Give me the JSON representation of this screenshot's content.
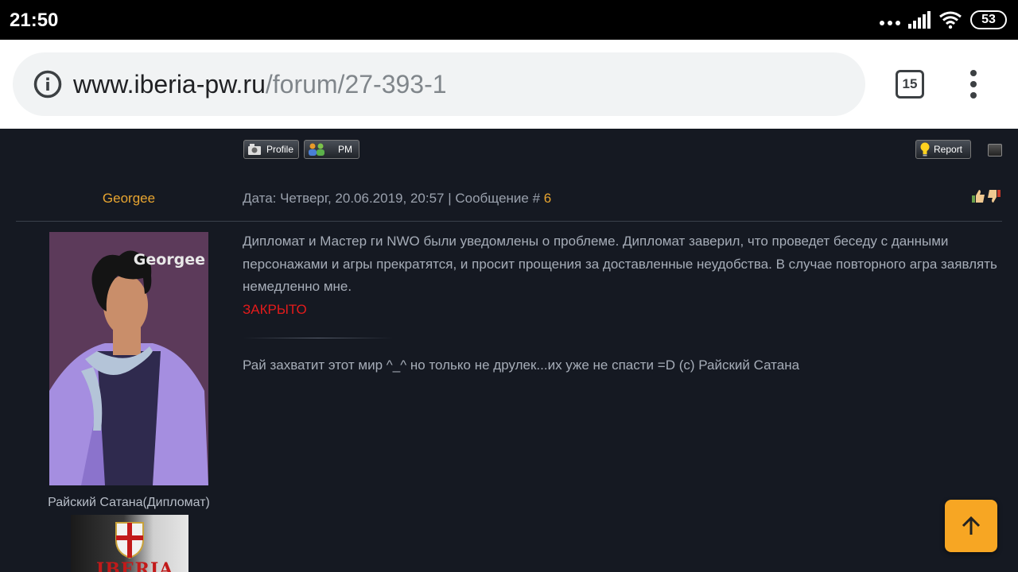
{
  "status": {
    "time": "21:50",
    "battery": "53"
  },
  "browser": {
    "url_host": "www.iberia-pw.ru",
    "url_path": "/forum/27-393-1",
    "tab_count": "15"
  },
  "post": {
    "buttons": {
      "profile": "Profile",
      "pm": "PM",
      "report": "Report"
    },
    "author": "Georgee",
    "meta_prefix": "Дата: Четверг, 20.06.2019, 20:57 | Сообщение # ",
    "post_number": "6",
    "avatar_caption": "Georgee",
    "author_group": "Райский Сатана(Дипломат)",
    "banner_text": "IBERIA",
    "body": "Дипломат и Мастер ги NWO были уведомлены о проблеме. Дипломат заверил, что проведет беседу с данными персонажами и агры прекратятся, и просит прощения за доставленные неудобства. В случае повторного агра заявлять немедленно мне.",
    "status_text": "ЗАКРЫТО",
    "signature": "Рай захватит этот мир ^_^ но только не друлек...их уже не спасти =D (c) Райский Сатана"
  },
  "colors": {
    "background": "#151922",
    "username": "#e8a530",
    "closed": "#e41b1b",
    "fab": "#f7a623"
  },
  "icons": {
    "info": "info-icon",
    "tabs": "tabs-icon",
    "menu": "more-vert-icon",
    "thumb_up": "thumb-up-icon",
    "thumb_down": "thumb-down-icon",
    "scroll_top": "arrow-up-icon"
  }
}
